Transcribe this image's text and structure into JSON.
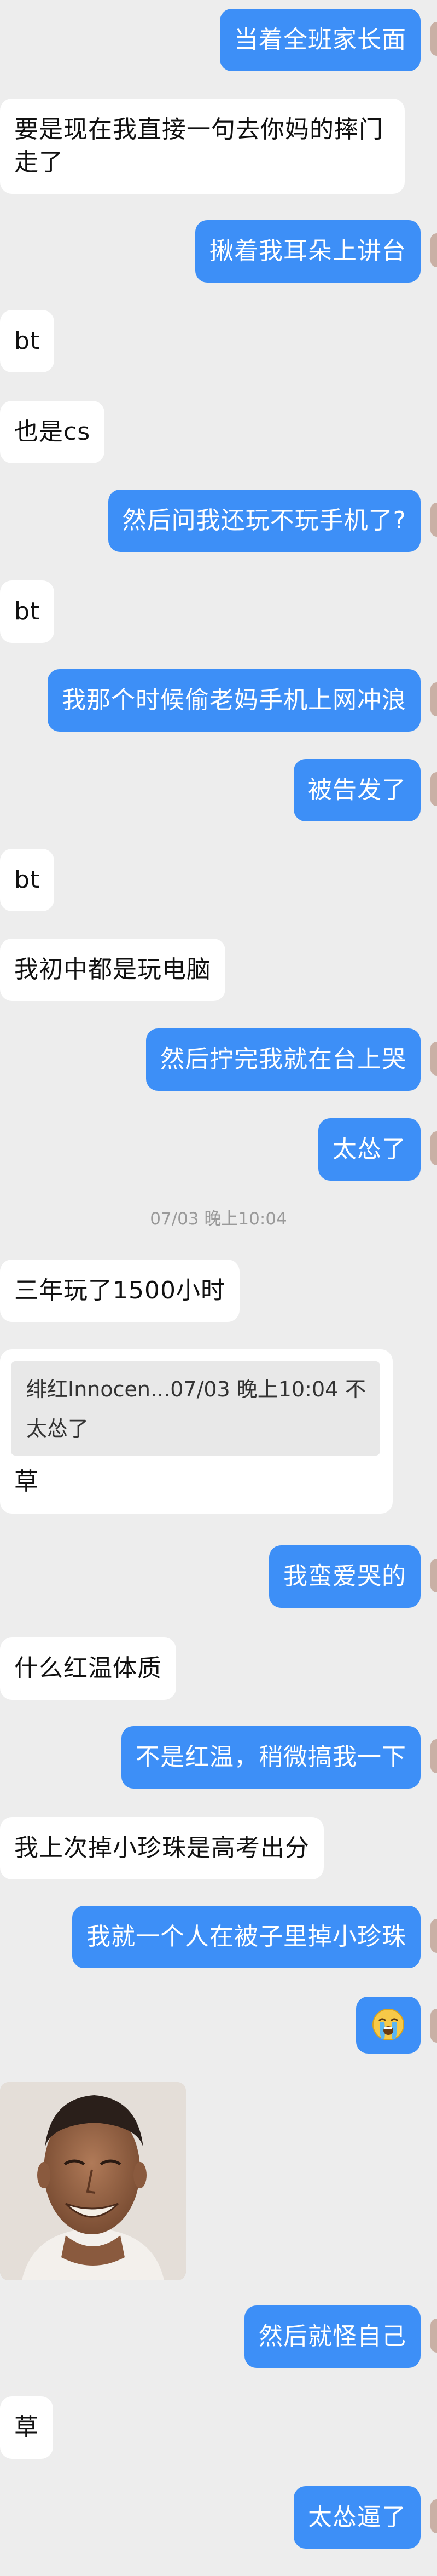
{
  "messages": [
    {
      "text": "当着全班家长面"
    },
    {
      "text": "要是现在我直接一句去你妈的摔门走了"
    },
    {
      "text": "揪着我耳朵上讲台"
    },
    {
      "text": "bt"
    },
    {
      "text": "也是cs"
    },
    {
      "text": "然后问我还玩不玩手机了?"
    },
    {
      "text": "bt"
    },
    {
      "text": "我那个时候偷老妈手机上网冲浪"
    },
    {
      "text": "被告发了"
    },
    {
      "text": "bt"
    },
    {
      "text": "我初中都是玩电脑"
    },
    {
      "text": "然后拧完我就在台上哭"
    },
    {
      "text": "太怂了"
    },
    {
      "text": "三年玩了1500小时"
    },
    {
      "text": "我蛮爱哭的"
    },
    {
      "text": "什么红温体质"
    },
    {
      "text": "不是红温，稍微搞我一下"
    },
    {
      "text": "我上次掉小珍珠是高考出分"
    },
    {
      "text": "我就一个人在被子里掉小珍珠"
    },
    {
      "text": "然后就怪自己"
    },
    {
      "text": "草"
    },
    {
      "text": "太怂逼了"
    }
  ],
  "timestamp": "07/03 晚上10:04",
  "quote": {
    "header": "绯红Innocen...07/03 晚上10:04",
    "close": "不",
    "quoted_text": "太怂了",
    "reply": "草"
  },
  "emoji": {
    "icon": "loudly-crying-face-icon"
  },
  "photo": {
    "icon": "smiling-man-photo"
  },
  "colors": {
    "background": "#ededed",
    "incoming_bubble": "#ffffff",
    "outgoing_bubble": "#3d8ff7",
    "timestamp_text": "#9a9a9a"
  }
}
